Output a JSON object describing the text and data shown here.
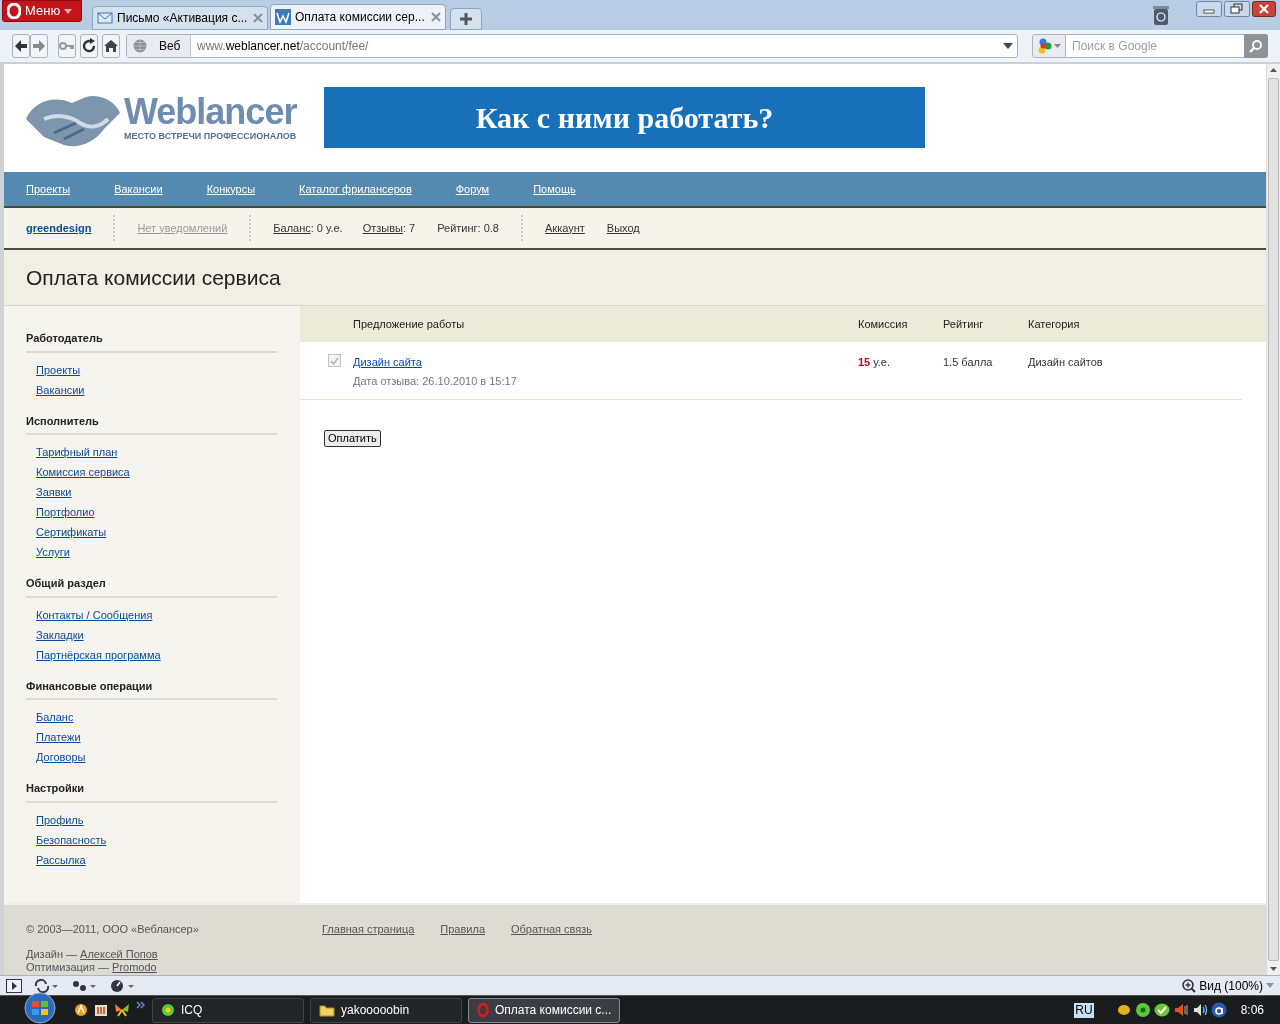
{
  "browser": {
    "menu": "Меню",
    "tabs": [
      {
        "title": "Письмо «Активация с...",
        "kind": "mail",
        "selected": false
      },
      {
        "title": "Оплата комиссии сер...",
        "kind": "site",
        "selected": true
      }
    ],
    "web_label": "Веб",
    "address": {
      "prefix": "www.",
      "host": "weblancer.net",
      "path": "/account/fee/"
    },
    "search": {
      "placeholder": "Поиск в Google"
    }
  },
  "page": {
    "logo": {
      "name": "Weblancer",
      "tagline": "МЕСТО ВСТРЕЧИ ПРОФЕССИОНАЛОВ"
    },
    "banner": "Как с ними работать?",
    "nav": [
      "Проекты",
      "Вакансии",
      "Конкурсы",
      "Каталог фрилансеров",
      "Форум",
      "Помощь"
    ],
    "userbar": {
      "username": "greendesign",
      "notifications": "Нет уведомлений",
      "balance_label": "Баланс",
      "balance_value": ": 0 у.е.",
      "reviews_label": "Отзывы",
      "reviews_value": ": 7",
      "rating": "Рейтинг: 0.8",
      "links": [
        "Аккаунт",
        "Выход"
      ]
    },
    "title": "Оплата комиссии сервиса",
    "sidebar": [
      {
        "heading": "Работодатель",
        "items": [
          "Проекты",
          "Вакансии"
        ]
      },
      {
        "heading": "Исполнитель",
        "items": [
          "Тарифный план",
          "Комиссия сервиса",
          "Заявки",
          "Портфолио",
          "Сертификаты",
          "Услуги"
        ]
      },
      {
        "heading": "Общий раздел",
        "items": [
          "Контакты / Сообщения",
          "Закладки",
          "Партнёрская программа"
        ]
      },
      {
        "heading": "Финансовые операции",
        "items": [
          "Баланс",
          "Платежи",
          "Договоры"
        ]
      },
      {
        "heading": "Настройки",
        "items": [
          "Профиль",
          "Безопасность",
          "Рассылка"
        ]
      }
    ],
    "table": {
      "columns": [
        "Предложение работы",
        "Комиссия",
        "Рейтинг",
        "Категория"
      ],
      "rows": [
        {
          "checked": true,
          "disabled": true,
          "title": "Дизайн сайта",
          "date": "Дата отзыва: 26.10.2010 в 15:17",
          "commission_value": "15",
          "commission_unit": " у.е.",
          "rating": "1.5 балла",
          "category": "Дизайн сайтов"
        }
      ]
    },
    "pay_button": "Оплатить",
    "footer": {
      "copyright": "© 2003—2011, ООО «Веблансер»",
      "links": [
        "Главная страница",
        "Правила",
        "Обратная связь"
      ],
      "credits": [
        {
          "label": "Дизайн — ",
          "link": "Алексей Попов"
        },
        {
          "label": "Оптимизация — ",
          "link": "Promodo"
        }
      ]
    }
  },
  "status_bar": {
    "zoom": "Вид (100%)"
  },
  "taskbar": {
    "tasks": [
      {
        "label": "ICQ",
        "kind": "icq",
        "selected": false
      },
      {
        "label": "yakooooobin",
        "kind": "folder",
        "selected": false
      },
      {
        "label": "Оплата комиссии с...",
        "kind": "opera",
        "selected": true
      }
    ],
    "language": "RU",
    "clock": "8:06"
  }
}
